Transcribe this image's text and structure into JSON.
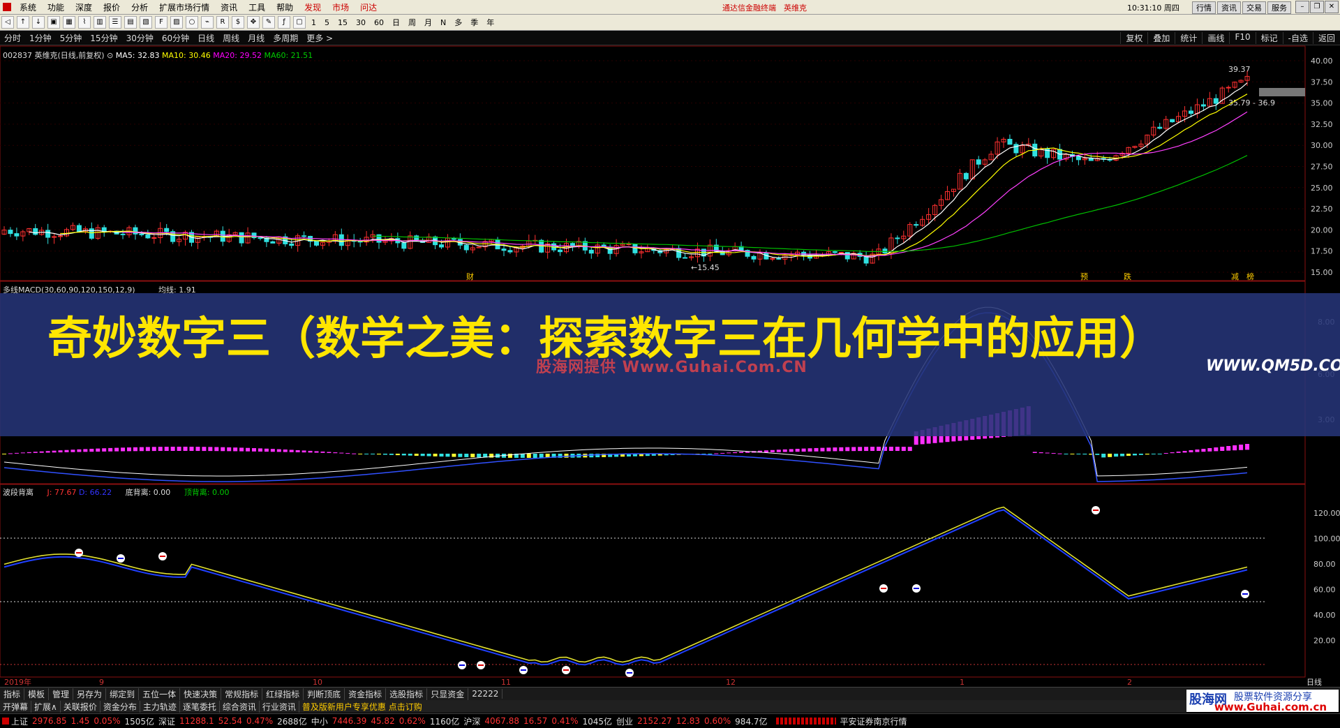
{
  "menu": {
    "items": [
      "系统",
      "功能",
      "深度",
      "报价",
      "分析",
      "扩展市场行情",
      "资讯",
      "工具",
      "帮助"
    ],
    "hot_items": [
      "发现",
      "市场",
      "问达"
    ],
    "notice": "通达信金融终端　英维克",
    "clock": "10:31:10 周四",
    "right_buttons": [
      "行情",
      "资讯",
      "交易",
      "服务"
    ]
  },
  "toolbar": {
    "periods": [
      "1",
      "5",
      "15",
      "30",
      "60",
      "日",
      "周",
      "月",
      "N",
      "多",
      "季",
      "年"
    ]
  },
  "period_bar": {
    "items": [
      "分时",
      "1分钟",
      "5分钟",
      "15分钟",
      "30分钟",
      "60分钟",
      "日线",
      "周线",
      "月线",
      "多周期",
      "更多 >"
    ],
    "right": [
      "复权",
      "叠加",
      "统计",
      "画线",
      "F10",
      "标记",
      "-自选",
      "返回"
    ]
  },
  "main_panel": {
    "stock": "002837 英维克(日线,前复权)",
    "ma": [
      {
        "label": "MA5: 32.83",
        "color": "#ffffff"
      },
      {
        "label": "MA10: 30.46",
        "color": "#ffff00"
      },
      {
        "label": "MA20: 29.52",
        "color": "#ff00ff"
      },
      {
        "label": "MA60: 21.51",
        "color": "#00cc00"
      }
    ],
    "y_ticks": [
      "40.00",
      "37.50",
      "35.00",
      "32.50",
      "30.00",
      "27.50",
      "25.00",
      "22.50",
      "20.00",
      "17.50",
      "15.00"
    ],
    "price_high": "39.37",
    "price_range": "35.79 - 36.9",
    "price_low": "←15.45",
    "event_marks": [
      "财",
      "预",
      "跌",
      "减",
      "榜"
    ]
  },
  "macd_panel": {
    "title": "多线MACD(30,60,90,120,150,12,9)",
    "junxian": "均线: 1.91",
    "y_ticks": [
      "8.00",
      "6.00",
      "3.00"
    ]
  },
  "bottom_panel": {
    "title": "波段背离",
    "j": "J: 77.67",
    "d": "D: 66.22",
    "dibeili": "底背离: 0.00",
    "dingbeili": "顶背离: 0.00",
    "y_ticks": [
      "120.00",
      "100.00",
      "80.00",
      "60.00",
      "40.00",
      "20.00"
    ]
  },
  "x_axis": {
    "labels": [
      "2019年",
      "9",
      "10",
      "11",
      "12",
      "1",
      "2"
    ],
    "right_label": "日线"
  },
  "banner": {
    "title": "奇妙数字三（数学之美：探索数字三在几何学中的应用）",
    "watermark": "股海网提供 Www.Guhai.Com.CN",
    "site": "WWW.QM5D.COM"
  },
  "bottom_tabs": [
    "指标",
    "模板",
    "管理",
    "另存为",
    "绑定到",
    "五位一体",
    "快速决策",
    "常规指标",
    "红绿指标",
    "判断顶底",
    "资金指标",
    "选股指标",
    "只显资金",
    "22222"
  ],
  "func_bar": [
    "开弹幕",
    "扩展∧",
    "关联报价",
    "资金分布",
    "主力轨迹",
    "逐笔委托",
    "综合资讯",
    "行业资讯",
    "普及版新用户专享优惠 点击订购"
  ],
  "ticker": [
    {
      "name": "上证",
      "price": "2976.85",
      "chg": "1.45",
      "pct": "0.05%",
      "vol": "1505亿"
    },
    {
      "name": "深证",
      "price": "11288.1",
      "chg": "52.54",
      "pct": "0.47%",
      "vol": "2688亿"
    },
    {
      "name": "中小",
      "price": "7446.39",
      "chg": "45.82",
      "pct": "0.62%",
      "vol": "1160亿"
    },
    {
      "name": "沪深",
      "price": "4067.88",
      "chg": "16.57",
      "pct": "0.41%",
      "vol": "1045亿"
    },
    {
      "name": "创业",
      "price": "2152.27",
      "chg": "12.83",
      "pct": "0.60%",
      "vol": "984.7亿"
    }
  ],
  "ticker_tail": "平安证券南京行情",
  "logo": {
    "a": "股海网",
    "b": "股票软件资源分享",
    "c": "www.Guhai.com.cn"
  }
}
